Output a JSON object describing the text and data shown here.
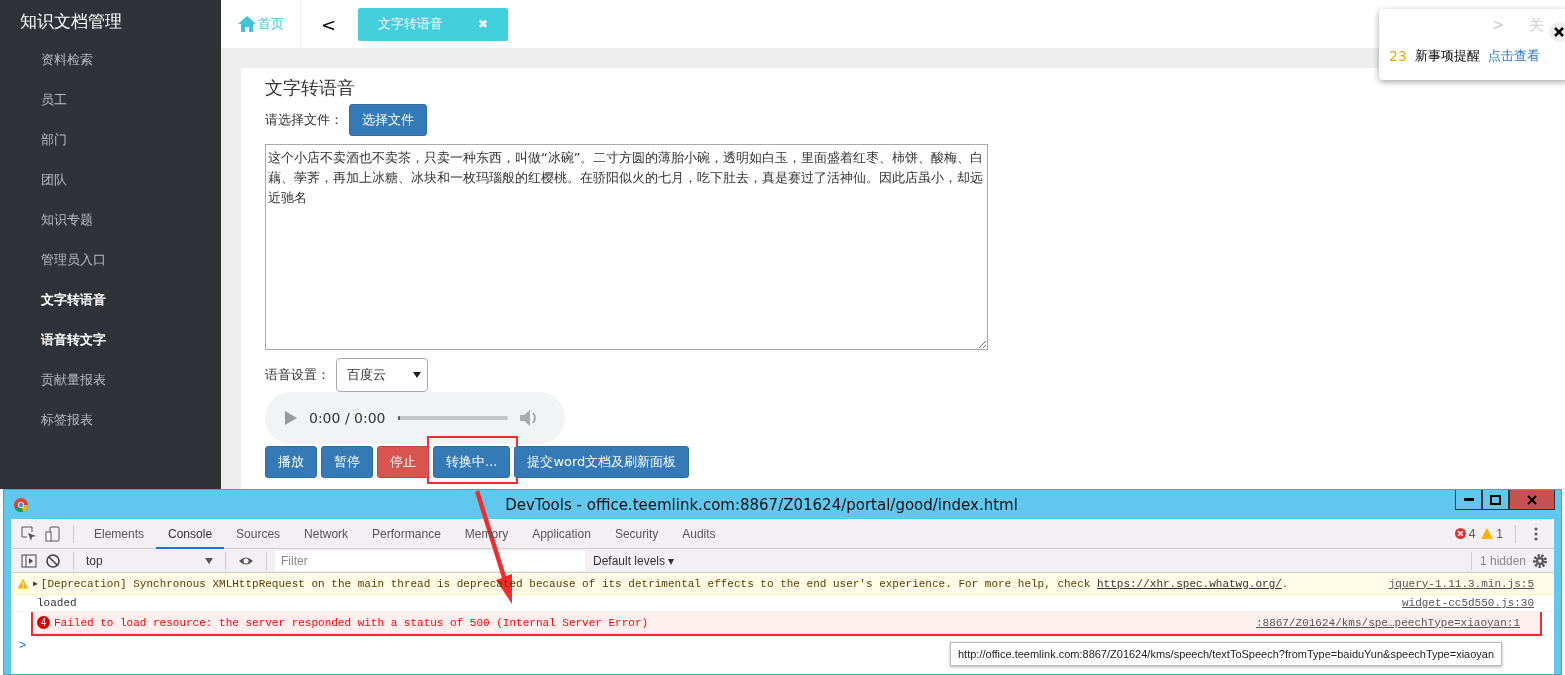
{
  "sidebar": {
    "title": "知识文档管理",
    "items": [
      {
        "label": "资料检索",
        "selected": false
      },
      {
        "label": "员工",
        "selected": false
      },
      {
        "label": "部门",
        "selected": false
      },
      {
        "label": "团队",
        "selected": false
      },
      {
        "label": "知识专题",
        "selected": false
      },
      {
        "label": "管理员入口",
        "selected": false
      },
      {
        "label": "文字转语音",
        "selected": true
      },
      {
        "label": "语音转文字",
        "selected": true
      },
      {
        "label": "贡献量报表",
        "selected": false
      },
      {
        "label": "标签报表",
        "selected": false
      }
    ]
  },
  "topbar": {
    "home": "首页",
    "back": "<",
    "tabs": [
      {
        "label": "文字转语音",
        "selected": true,
        "close": "✖"
      }
    ]
  },
  "notification": {
    "chevron": ">",
    "close_label": "关",
    "count": "23",
    "message": "新事项提醒",
    "link": "点击查看"
  },
  "card": {
    "title": "文字转语音",
    "file_label": "请选择文件：",
    "file_button": "选择文件",
    "text_value": "这个小店不卖酒也不卖茶，只卖一种东西，叫做“冰碗”。二寸方圆的薄胎小碗，透明如白玉，里面盛着红枣、柿饼、酸梅、白藕、荸荠，再加上冰糖、冰块和一枚玛瑙般的红樱桃。在骄阳似火的七月，吃下肚去，真是赛过了活神仙。因此店虽小，却远近驰名",
    "voice_label": "语音设置：",
    "voice_value": "百度云",
    "player": {
      "time": "0:00 / 0:00",
      "level": 0
    },
    "buttons": [
      {
        "label": "播放",
        "kind": "primary",
        "highlighted": false
      },
      {
        "label": "暂停",
        "kind": "primary",
        "highlighted": false
      },
      {
        "label": "停止",
        "kind": "danger",
        "highlighted": false
      },
      {
        "label": "转换中...",
        "kind": "primary",
        "highlighted": true
      },
      {
        "label": "提交word文档及刷新面板",
        "kind": "primary",
        "highlighted": false
      }
    ]
  },
  "devtools": {
    "title": "DevTools - office.teemlink.com:8867/Z01624/portal/good/index.html",
    "tabs": [
      {
        "label": "Elements",
        "selected": false
      },
      {
        "label": "Console",
        "selected": true
      },
      {
        "label": "Sources",
        "selected": false
      },
      {
        "label": "Network",
        "selected": false
      },
      {
        "label": "Performance",
        "selected": false
      },
      {
        "label": "Memory",
        "selected": false
      },
      {
        "label": "Application",
        "selected": false
      },
      {
        "label": "Security",
        "selected": false
      },
      {
        "label": "Audits",
        "selected": false
      }
    ],
    "error_count": "4",
    "warning_count": "1",
    "context": "top",
    "filter_placeholder": "Filter",
    "levels": "Default levels",
    "levels_caret": "▾",
    "hidden": "1 hidden",
    "messages": [
      {
        "kind": "warning",
        "expand": "▶",
        "text": "[Deprecation] Synchronous XMLHttpRequest on the main thread is deprecated because of its detrimental effects to the end user's experience. For more help, check ",
        "link": "https://xhr.spec.whatwg.org/",
        "tail": ".",
        "source": "jquery-1.11.3.min.js:5",
        "highlighted": false
      },
      {
        "kind": "log",
        "text": "loaded",
        "source": "widget-cc5d550.js:30",
        "highlighted": false
      },
      {
        "kind": "error",
        "badge": "4",
        "text": "Failed to load resource: the server responded with a status of 500 (Internal Server Error)",
        "source": ":8867/Z01624/kms/spe…peechType=xiaoyan:1",
        "highlighted": true
      }
    ],
    "prompt": ">",
    "tooltip": "http://office.teemlink.com:8867/Z01624/kms/speech/textToSpeech?fromType=baiduYun&speechType=xiaoyan"
  }
}
